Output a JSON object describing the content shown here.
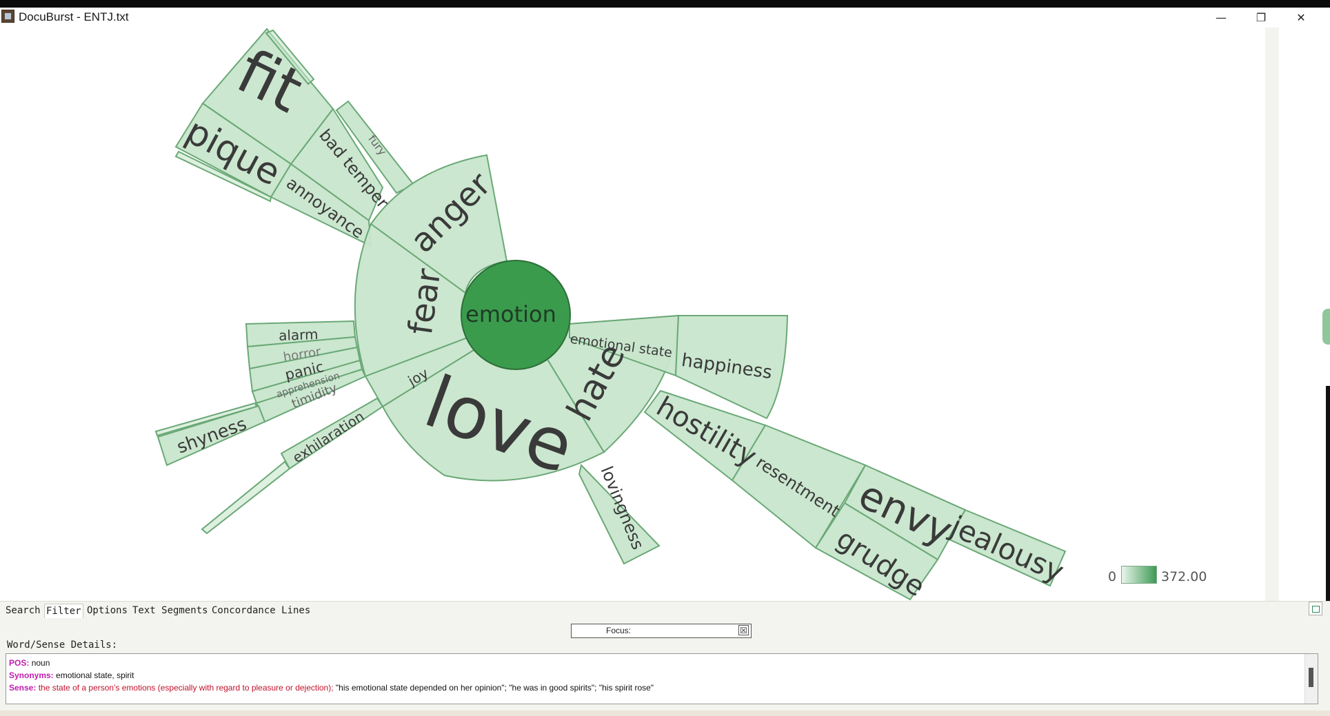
{
  "window": {
    "title": "DocuBurst - ENTJ.txt",
    "controls": {
      "minimize": "—",
      "maximize": "❐",
      "close": "✕"
    }
  },
  "sunburst": {
    "root": "emotion",
    "colors": {
      "root": "#3a9b4d",
      "node": "#c8e6cc",
      "node_strong": "#b3dab9",
      "stroke": "#6aa876",
      "label": "#3a3a3a"
    },
    "labels": {
      "fit": "fit",
      "pique": "pique",
      "bad_temper": "bad temper",
      "fury": "fury",
      "annoyance": "annoyance",
      "anger": "anger",
      "fear": "fear",
      "alarm": "alarm",
      "horror": "horror",
      "panic": "panic",
      "apprehension": "apprehension",
      "timidity": "timidity",
      "shyness": "shyness",
      "joy": "joy",
      "exhilaration": "exhilaration",
      "love": "love",
      "hate": "hate",
      "emotional_state": "emotional state",
      "happiness": "happiness",
      "hostility": "hostility",
      "resentment": "resentment",
      "envy": "envy",
      "jealousy": "jealousy",
      "grudge": "grudge",
      "lovingness": "lovingness"
    }
  },
  "legend": {
    "min": "0",
    "max": "372.00"
  },
  "tabs": [
    "Search",
    "Filter",
    "Options",
    "Text Segments",
    "Concordance Lines"
  ],
  "focus": {
    "label": "Focus:",
    "clear_icon": "☒"
  },
  "details": {
    "heading": "Word/Sense Details:",
    "pos_key": "POS:",
    "pos_val": "noun",
    "syn_key": "Synonyms:",
    "syn_val": "emotional state, spirit",
    "sense_key": "Sense:",
    "sense_def": "the state of a person's emotions (especially with regard to pleasure or dejection);",
    "sense_examples": "\"his emotional state depended on her opinion\"; \"he was in good spirits\"; \"his spirit rose\""
  }
}
